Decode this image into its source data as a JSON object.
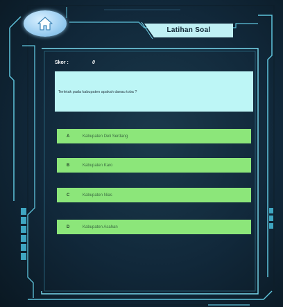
{
  "header": {
    "title": "Latihan Soal",
    "home_icon": "home-icon"
  },
  "score": {
    "label": "Skor :",
    "value": "0"
  },
  "question": {
    "text": "Terletak pada kabupaten apakah danau toba ?"
  },
  "options": [
    {
      "letter": "A",
      "text": "Kabupaten Deli Serdang"
    },
    {
      "letter": "B",
      "text": "Kabupaten Karo"
    },
    {
      "letter": "C",
      "text": "Kabupaten Nias"
    },
    {
      "letter": "D",
      "text": "Kabupaten Asahan"
    }
  ],
  "colors": {
    "background": "#11283a",
    "frame": "#6fd1e6",
    "question_box": "#bdf6f6",
    "option": "#8ce67a",
    "title_tab": "#bff0f4"
  }
}
